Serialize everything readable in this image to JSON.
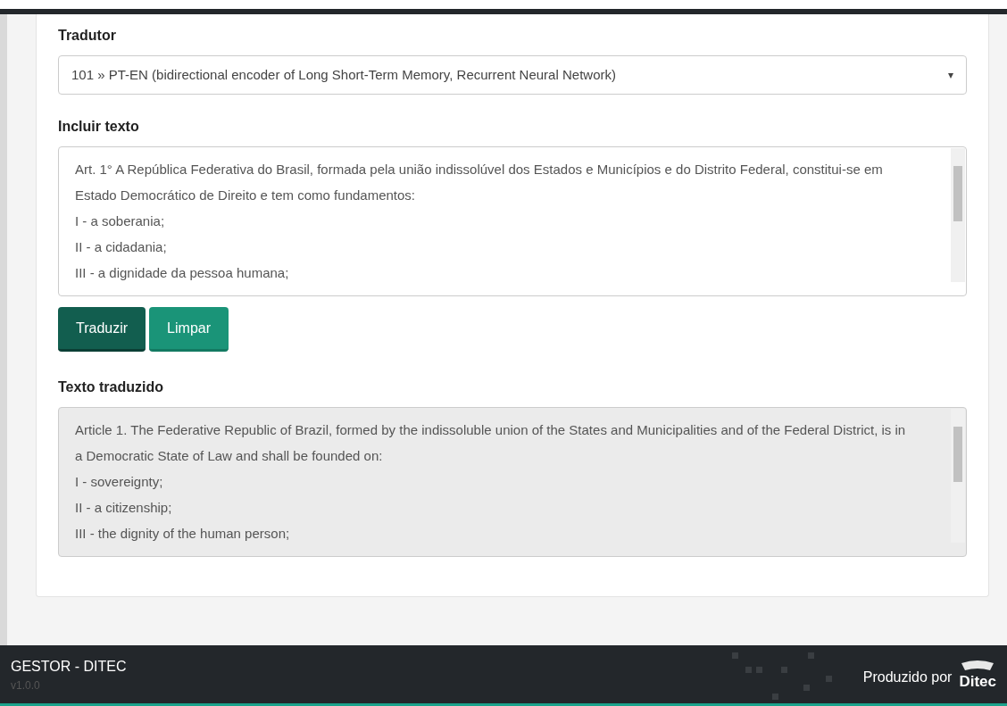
{
  "translator": {
    "label": "Tradutor",
    "value": "101 » PT-EN (bidirectional encoder of Long Short-Term Memory, Recurrent Neural Network)",
    "caret": "▾"
  },
  "input": {
    "label": "Incluir texto",
    "lines": [
      "Art. 1° A República Federativa do Brasil, formada pela união indissolúvel dos Estados e Municípios e do Distrito Federal, constitui-se em Estado Democrático de Direito e tem como fundamentos:",
      "I - a soberania;",
      "II - a cidadania;",
      "III - a dignidade da pessoa humana;"
    ]
  },
  "buttons": [
    {
      "label": "Traduzir",
      "kind": "primary"
    },
    {
      "label": "Limpar",
      "kind": "secondary"
    }
  ],
  "output": {
    "label": "Texto traduzido",
    "disabled": true,
    "lines": [
      "Article 1. The Federative Republic of Brazil, formed by the indissoluble union of the States and Municipalities and of the Federal District, is in a Democratic State of Law and shall be founded on:",
      "I - sovereignty;",
      "II - a citizenship;",
      "III - the dignity of the human person;"
    ]
  },
  "footer": {
    "title": "GESTOR - DITEC",
    "version": "v1.0.0",
    "credit": "Produzido por",
    "brand": "Ditec"
  }
}
